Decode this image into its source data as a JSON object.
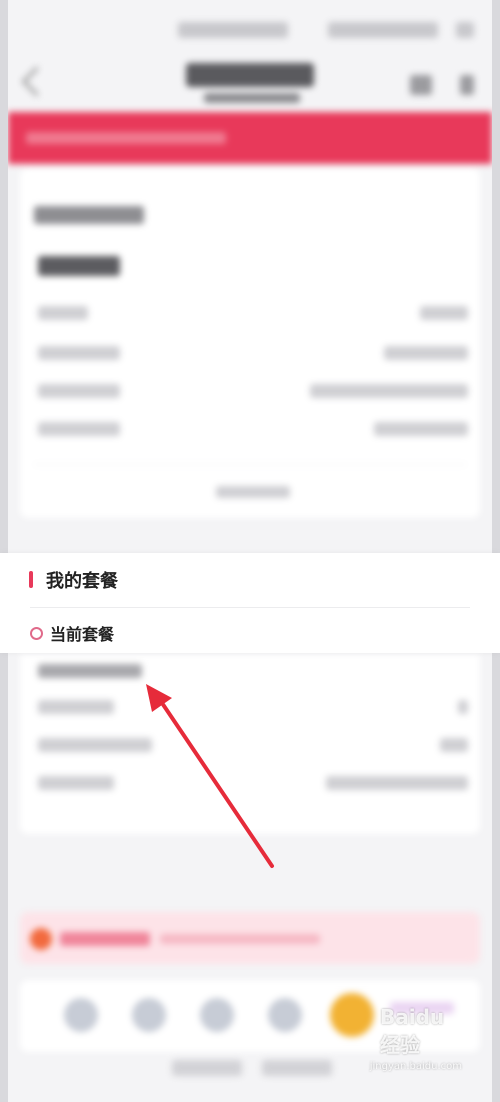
{
  "section": {
    "title": "我的套餐",
    "subtitle": "当前套餐"
  },
  "colors": {
    "accent": "#e8395a",
    "ring": "#e06a8a",
    "arrow": "#e62b3a"
  },
  "watermark": {
    "brand": "Baidu",
    "suffix": "经验",
    "url": "jingyan.baidu.com"
  },
  "icons": [
    "back-icon",
    "menu-icon",
    "more-icon",
    "arrow-annotation-icon"
  ]
}
